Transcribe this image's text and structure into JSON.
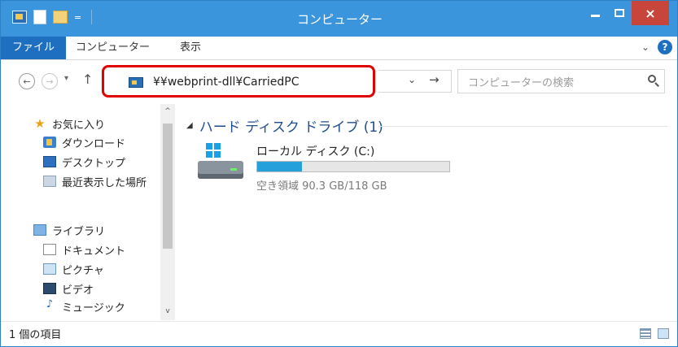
{
  "window": {
    "title": "コンピューター",
    "close_glyph": "×",
    "minimize_glyph": "-",
    "qat_dropdown": "="
  },
  "ribbon": {
    "tabs": [
      "ファイル",
      "コンピューター",
      "表示"
    ],
    "collapse_glyph": "⌄",
    "help_glyph": "?"
  },
  "address": {
    "path": "¥¥webprint-dll¥CarriedPC",
    "dropdown_glyph": "⌄",
    "refresh_glyph": "→",
    "search_placeholder": "コンピューターの検索",
    "back_glyph": "←",
    "forward_glyph": "→",
    "history_glyph": "▾",
    "up_glyph": "↑"
  },
  "nav_pane": {
    "items": [
      {
        "label": "お気に入り",
        "icon": "star-icon"
      },
      {
        "label": "ダウンロード",
        "icon": "download-icon"
      },
      {
        "label": "デスクトップ",
        "icon": "desktop-icon"
      },
      {
        "label": "最近表示した場所",
        "icon": "recent-places-icon"
      },
      {
        "label": "ライブラリ",
        "icon": "library-icon"
      },
      {
        "label": "ドキュメント",
        "icon": "document-icon"
      },
      {
        "label": "ピクチャ",
        "icon": "picture-icon"
      },
      {
        "label": "ビデオ",
        "icon": "video-icon"
      },
      {
        "label": "ミュージック",
        "icon": "music-icon"
      }
    ],
    "scroll_up_glyph": "^",
    "scroll_down_glyph": "v"
  },
  "content": {
    "group_caret": "◢",
    "group_header": "ハード ディスク ドライブ (1)",
    "drives": [
      {
        "name": "ローカル ディスク (C:)",
        "free_text": "空き領域 90.3 GB/118 GB",
        "used_fraction": 0.235,
        "icon": "hard-drive-icon"
      }
    ]
  },
  "status": {
    "item_count": "1 個の項目"
  },
  "colors": {
    "titlebar": "#3a95dc",
    "file_tab": "#1f6fc1",
    "highlight_border": "#e10000",
    "close_button": "#c7453a",
    "drive_bar_fill": "#26a0da"
  }
}
